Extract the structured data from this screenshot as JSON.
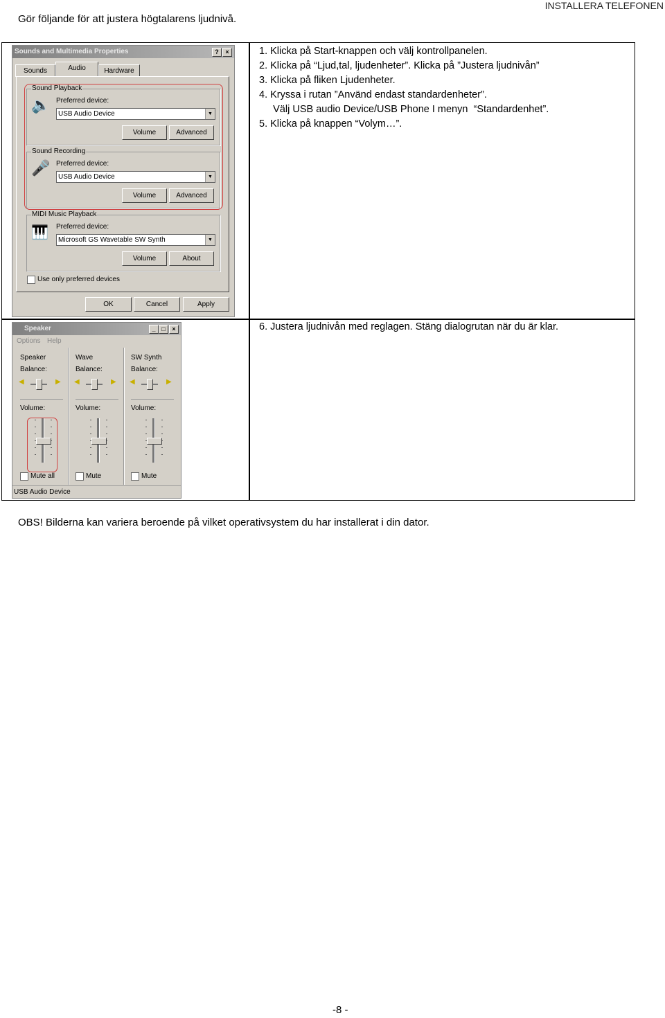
{
  "header": {
    "intro": "Gör följande för att justera högtalarens ljudnivå.",
    "section": "INSTALLERA TELEFONEN"
  },
  "steps": [
    "1.  Klicka på Start-knappen och välj kontrollpanelen.",
    "2.  Klicka på “Ljud,tal, ljudenheter”. Klicka på ”Justera ljudnivån”",
    "3.  Klicka på fliken Ljudenheter.",
    "4.  Kryssa i rutan ”Använd endast standardenheter”.",
    "     Välj USB audio Device/USB Phone I menyn  “Standardenhet”.",
    "5.  Klicka på knappen “Volym…”."
  ],
  "step6": "6.  Justera ljudnivån med reglagen. Stäng dialogrutan när du är klar.",
  "note": "OBS! Bilderna kan variera beroende på vilket operativsystem du har installerat i din dator.",
  "page_number": "-8 -",
  "dialog1": {
    "title": "Sounds and Multimedia Properties",
    "help": "?",
    "close": "×",
    "tabs": [
      "Sounds",
      "Audio",
      "Hardware"
    ],
    "playback": {
      "label": "Sound Playback",
      "pref": "Preferred device:",
      "device": "USB Audio Device",
      "volume": "Volume",
      "advanced": "Advanced"
    },
    "recording": {
      "label": "Sound Recording",
      "pref": "Preferred device:",
      "device": "USB Audio Device",
      "volume": "Volume",
      "advanced": "Advanced"
    },
    "midi": {
      "label": "MIDI Music Playback",
      "pref": "Preferred device:",
      "device": "Microsoft GS Wavetable SW Synth",
      "volume": "Volume",
      "about": "About"
    },
    "checkbox": "Use only preferred devices",
    "ok": "OK",
    "cancel": "Cancel",
    "apply": "Apply"
  },
  "dialog2": {
    "title": "Speaker",
    "menu": [
      "Options",
      "Help"
    ],
    "channels": [
      {
        "name": "Speaker",
        "balance": "Balance:",
        "volume": "Volume:",
        "mute": "Mute all"
      },
      {
        "name": "Wave",
        "balance": "Balance:",
        "volume": "Volume:",
        "mute": "Mute"
      },
      {
        "name": "SW Synth",
        "balance": "Balance:",
        "volume": "Volume:",
        "mute": "Mute"
      }
    ],
    "status": "USB Audio Device"
  },
  "colors": {
    "highlight": "#d04040",
    "dialog": "#d4d0c8"
  }
}
